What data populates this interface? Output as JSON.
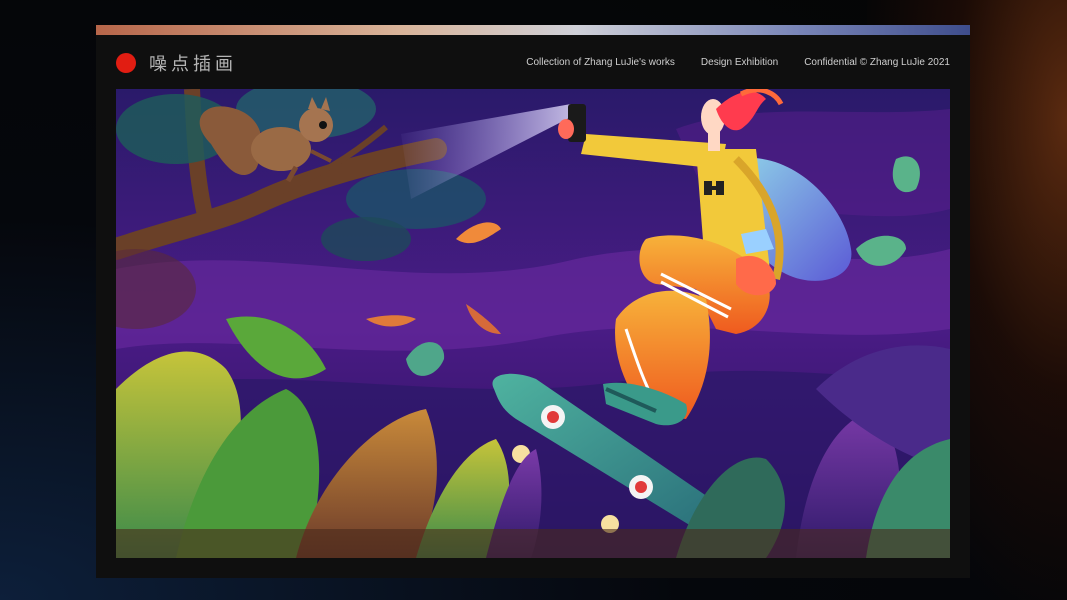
{
  "header": {
    "brand": "噪点插画",
    "nav": [
      {
        "label": "Collection of Zhang LuJie's works"
      },
      {
        "label": "Design Exhibition"
      },
      {
        "label": "Confidential © Zhang LuJie 2021"
      }
    ]
  },
  "colors": {
    "brand_dot": "#e11d12",
    "frame_bg": "#0f0f0f",
    "sky": "#3d1a7a",
    "shirt": "#f2c93a",
    "hair": "#ff3b4e",
    "skateboard": "#3aa693"
  },
  "illustration": {
    "icons": [
      "squirrel-icon",
      "skateboarder-figure",
      "phone-icon",
      "binoculars-icon",
      "backpack-icon",
      "skateboard-icon",
      "leaf-icon"
    ]
  }
}
